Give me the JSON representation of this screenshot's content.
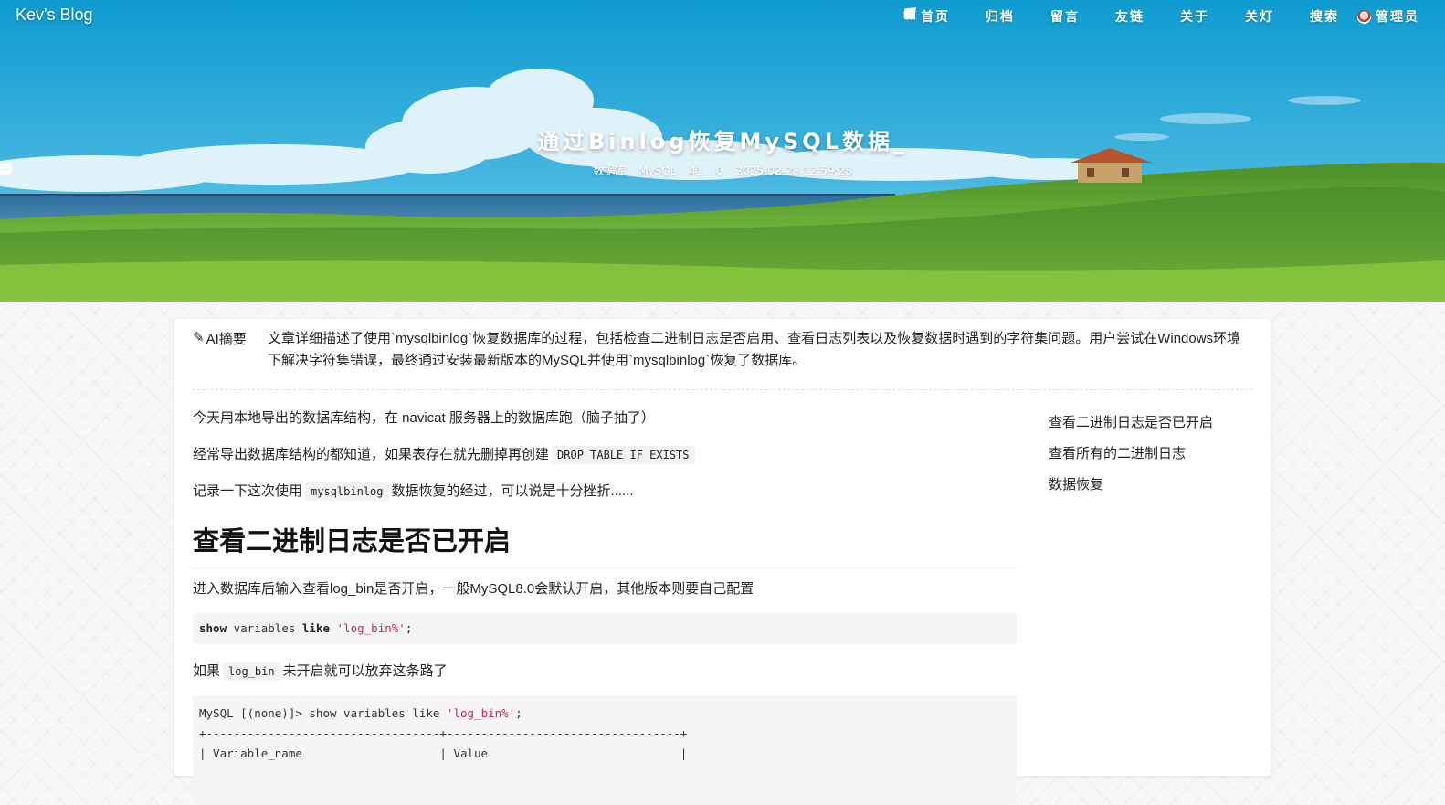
{
  "header": {
    "brand": "Kev's Blog",
    "nav": [
      {
        "label": "首页",
        "icon": "home-icon"
      },
      {
        "label": "归档",
        "icon": "archive-icon"
      },
      {
        "label": "留言",
        "icon": "message-icon"
      },
      {
        "label": "友链",
        "icon": "link-icon"
      },
      {
        "label": "关于",
        "icon": "send-icon"
      },
      {
        "label": "关灯",
        "icon": "moon-icon"
      },
      {
        "label": "搜索",
        "icon": "search-icon"
      },
      {
        "label": "管理员",
        "icon": "avatar"
      }
    ]
  },
  "post": {
    "title": "通过Binlog恢复MySQL数据_",
    "category": "数据库",
    "tag": "MySQL",
    "views": "41",
    "comments": "0",
    "date": "2025-02-28 12:59:28"
  },
  "summary": {
    "label": "AI摘要",
    "text": "文章详细描述了使用`mysqlbinlog`恢复数据库的过程，包括检查二进制日志是否启用、查看日志列表以及恢复数据时遇到的字符集问题。用户尝试在Windows环境下解决字符集错误，最终通过安装最新版本的MySQL并使用`mysqlbinlog`恢复了数据库。"
  },
  "article": {
    "p1": "今天用本地导出的数据库结构，在 navicat 服务器上的数据库跑（脑子抽了）",
    "p2_pre": "经常导出数据库结构的都知道，如果表存在就先删掉再创建",
    "p2_code": "DROP TABLE IF EXISTS",
    "p3_pre": "记录一下这次使用",
    "p3_code": "mysqlbinlog",
    "p3_post": "数据恢复的经过，可以说是十分挫折......",
    "h2": "查看二进制日志是否已开启",
    "p4": "进入数据库后输入查看log_bin是否开启，一般MySQL8.0会默认开启，其他版本则要自己配置",
    "code1": {
      "kw1": "show",
      "mid": " variables ",
      "kw2": "like",
      "str": "'log_bin%'",
      "end": ";"
    },
    "p5_pre": "如果",
    "p5_code": "log_bin",
    "p5_post": "未开启就可以放弃这条路了",
    "code2": {
      "line1_pre": "MySQL [(none)]> show variables like ",
      "line1_str": "'log_bin%'",
      "line1_end": ";",
      "line2": "+----------------------------------+----------------------------------+",
      "line3": "| Variable_name                    | Value                            |"
    }
  },
  "toc": [
    "查看二进制日志是否已开启",
    "查看所有的二进制日志",
    "数据恢复"
  ]
}
